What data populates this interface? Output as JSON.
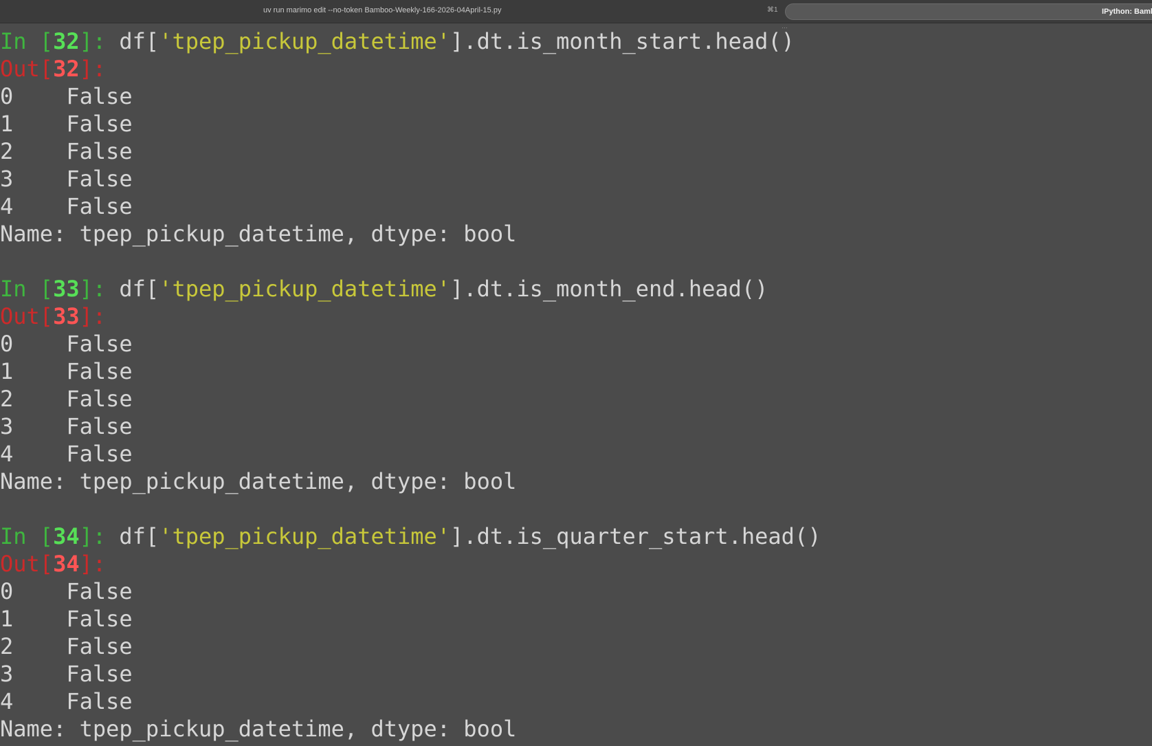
{
  "tabs": {
    "inactive_title": "uv run marimo edit --no-token Bamboo-Weekly-166-2026-04April-15.py",
    "inactive_shortcut": "⌘1",
    "active_title": "IPython: Bamb"
  },
  "overflow_marker": "…",
  "session": {
    "in_label": "In",
    "out_label": "Out",
    "cells": [
      {
        "number": "32",
        "code_prefix": "df[",
        "code_string": "'tpep_pickup_datetime'",
        "code_suffix": "].dt.is_month_start.head()",
        "rows": [
          {
            "index": "0",
            "value": "False"
          },
          {
            "index": "1",
            "value": "False"
          },
          {
            "index": "2",
            "value": "False"
          },
          {
            "index": "3",
            "value": "False"
          },
          {
            "index": "4",
            "value": "False"
          }
        ],
        "footer": "Name: tpep_pickup_datetime, dtype: bool"
      },
      {
        "number": "33",
        "code_prefix": "df[",
        "code_string": "'tpep_pickup_datetime'",
        "code_suffix": "].dt.is_month_end.head()",
        "rows": [
          {
            "index": "0",
            "value": "False"
          },
          {
            "index": "1",
            "value": "False"
          },
          {
            "index": "2",
            "value": "False"
          },
          {
            "index": "3",
            "value": "False"
          },
          {
            "index": "4",
            "value": "False"
          }
        ],
        "footer": "Name: tpep_pickup_datetime, dtype: bool"
      },
      {
        "number": "34",
        "code_prefix": "df[",
        "code_string": "'tpep_pickup_datetime'",
        "code_suffix": "].dt.is_quarter_start.head()",
        "rows": [
          {
            "index": "0",
            "value": "False"
          },
          {
            "index": "1",
            "value": "False"
          },
          {
            "index": "2",
            "value": "False"
          },
          {
            "index": "3",
            "value": "False"
          },
          {
            "index": "4",
            "value": "False"
          }
        ],
        "footer": "Name: tpep_pickup_datetime, dtype: bool"
      }
    ]
  },
  "colors": {
    "background": "#4b4b4b",
    "prompt_in": "#3fb63f",
    "prompt_in_number": "#57e057",
    "prompt_out": "#cc2a2a",
    "prompt_out_number": "#ff5555",
    "string_literal": "#c8c83a",
    "text": "#d6d6d6"
  }
}
